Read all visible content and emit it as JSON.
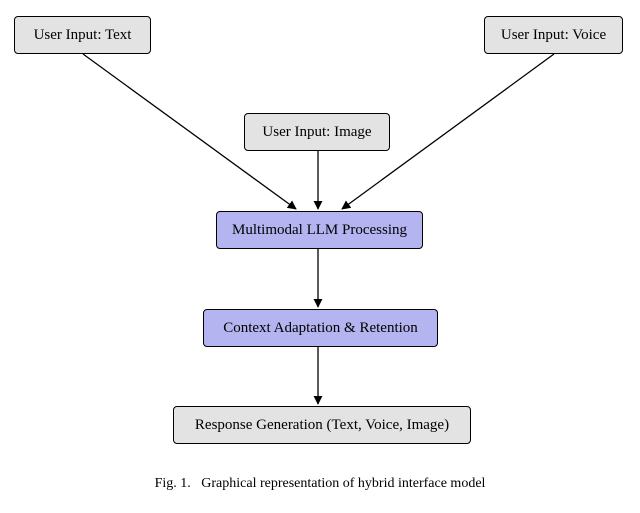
{
  "diagram": {
    "nodes": {
      "input_text": {
        "label": "User Input: Text"
      },
      "input_voice": {
        "label": "User Input: Voice"
      },
      "input_image": {
        "label": "User Input: Image"
      },
      "processing": {
        "label": "Multimodal LLM Processing"
      },
      "context": {
        "label": "Context Adaptation & Retention"
      },
      "response": {
        "label": "Response Generation (Text, Voice, Image)"
      }
    },
    "caption_prefix": "Fig. 1.",
    "caption_text": "Graphical representation of hybrid interface model"
  },
  "chart_data": {
    "type": "diagram",
    "nodes": [
      {
        "id": "input_text",
        "label": "User Input: Text",
        "kind": "input"
      },
      {
        "id": "input_voice",
        "label": "User Input: Voice",
        "kind": "input"
      },
      {
        "id": "input_image",
        "label": "User Input: Image",
        "kind": "input"
      },
      {
        "id": "processing",
        "label": "Multimodal LLM Processing",
        "kind": "process"
      },
      {
        "id": "context",
        "label": "Context Adaptation & Retention",
        "kind": "process"
      },
      {
        "id": "response",
        "label": "Response Generation (Text, Voice, Image)",
        "kind": "output"
      }
    ],
    "edges": [
      {
        "from": "input_text",
        "to": "processing"
      },
      {
        "from": "input_voice",
        "to": "processing"
      },
      {
        "from": "input_image",
        "to": "processing"
      },
      {
        "from": "processing",
        "to": "context"
      },
      {
        "from": "context",
        "to": "response"
      }
    ],
    "title": "Graphical representation of hybrid interface model"
  }
}
